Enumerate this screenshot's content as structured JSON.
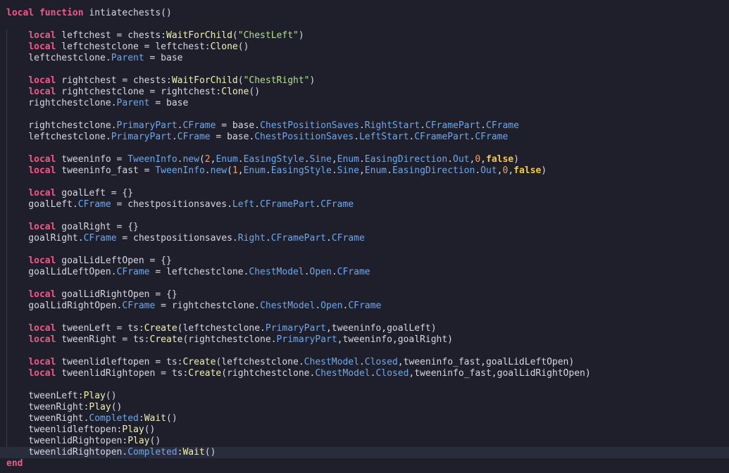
{
  "code_lines": [
    [
      [
        "kw",
        "local function "
      ],
      [
        "plain",
        "intiatechests()"
      ]
    ],
    [],
    [
      [
        "plain",
        "    "
      ],
      [
        "kw",
        "local"
      ],
      [
        "plain",
        " leftchest = chests:"
      ],
      [
        "fn",
        "WaitForChild"
      ],
      [
        "plain",
        "("
      ],
      [
        "str",
        "\"ChestLeft\""
      ],
      [
        "plain",
        ")"
      ]
    ],
    [
      [
        "plain",
        "    "
      ],
      [
        "kw",
        "local"
      ],
      [
        "plain",
        " leftchestclone = leftchest:"
      ],
      [
        "fn",
        "Clone"
      ],
      [
        "plain",
        "()"
      ]
    ],
    [
      [
        "plain",
        "    leftchestclone."
      ],
      [
        "prop",
        "Parent"
      ],
      [
        "plain",
        " = base"
      ]
    ],
    [],
    [
      [
        "plain",
        "    "
      ],
      [
        "kw",
        "local"
      ],
      [
        "plain",
        " rightchest = chests:"
      ],
      [
        "fn",
        "WaitForChild"
      ],
      [
        "plain",
        "("
      ],
      [
        "str",
        "\"ChestRight\""
      ],
      [
        "plain",
        ")"
      ]
    ],
    [
      [
        "plain",
        "    "
      ],
      [
        "kw",
        "local"
      ],
      [
        "plain",
        " rightchestclone = rightchest:"
      ],
      [
        "fn",
        "Clone"
      ],
      [
        "plain",
        "()"
      ]
    ],
    [
      [
        "plain",
        "    rightchestclone."
      ],
      [
        "prop",
        "Parent"
      ],
      [
        "plain",
        " = base"
      ]
    ],
    [],
    [
      [
        "plain",
        "    rightchestclone."
      ],
      [
        "prop",
        "PrimaryPart"
      ],
      [
        "plain",
        "."
      ],
      [
        "prop",
        "CFrame"
      ],
      [
        "plain",
        " = base."
      ],
      [
        "prop",
        "ChestPositionSaves"
      ],
      [
        "plain",
        "."
      ],
      [
        "prop",
        "RightStart"
      ],
      [
        "plain",
        "."
      ],
      [
        "prop",
        "CFramePart"
      ],
      [
        "plain",
        "."
      ],
      [
        "prop",
        "CFrame"
      ]
    ],
    [
      [
        "plain",
        "    leftchestclone."
      ],
      [
        "prop",
        "PrimaryPart"
      ],
      [
        "plain",
        "."
      ],
      [
        "prop",
        "CFrame"
      ],
      [
        "plain",
        " = base."
      ],
      [
        "prop",
        "ChestPositionSaves"
      ],
      [
        "plain",
        "."
      ],
      [
        "prop",
        "LeftStart"
      ],
      [
        "plain",
        "."
      ],
      [
        "prop",
        "CFramePart"
      ],
      [
        "plain",
        "."
      ],
      [
        "prop",
        "CFrame"
      ]
    ],
    [],
    [
      [
        "plain",
        "    "
      ],
      [
        "kw",
        "local"
      ],
      [
        "plain",
        " tweeninfo = "
      ],
      [
        "prop",
        "TweenInfo"
      ],
      [
        "plain",
        "."
      ],
      [
        "prop",
        "new"
      ],
      [
        "plain",
        "("
      ],
      [
        "num",
        "2"
      ],
      [
        "plain",
        ","
      ],
      [
        "prop",
        "Enum"
      ],
      [
        "plain",
        "."
      ],
      [
        "prop",
        "EasingStyle"
      ],
      [
        "plain",
        "."
      ],
      [
        "prop",
        "Sine"
      ],
      [
        "plain",
        ","
      ],
      [
        "prop",
        "Enum"
      ],
      [
        "plain",
        "."
      ],
      [
        "prop",
        "EasingDirection"
      ],
      [
        "plain",
        "."
      ],
      [
        "prop",
        "Out"
      ],
      [
        "plain",
        ","
      ],
      [
        "num",
        "0"
      ],
      [
        "plain",
        ","
      ],
      [
        "bool",
        "false"
      ],
      [
        "plain",
        ")"
      ]
    ],
    [
      [
        "plain",
        "    "
      ],
      [
        "kw",
        "local"
      ],
      [
        "plain",
        " tweeninfo_fast = "
      ],
      [
        "prop",
        "TweenInfo"
      ],
      [
        "plain",
        "."
      ],
      [
        "prop",
        "new"
      ],
      [
        "plain",
        "("
      ],
      [
        "num",
        "1"
      ],
      [
        "plain",
        ","
      ],
      [
        "prop",
        "Enum"
      ],
      [
        "plain",
        "."
      ],
      [
        "prop",
        "EasingStyle"
      ],
      [
        "plain",
        "."
      ],
      [
        "prop",
        "Sine"
      ],
      [
        "plain",
        ","
      ],
      [
        "prop",
        "Enum"
      ],
      [
        "plain",
        "."
      ],
      [
        "prop",
        "EasingDirection"
      ],
      [
        "plain",
        "."
      ],
      [
        "prop",
        "Out"
      ],
      [
        "plain",
        ","
      ],
      [
        "num",
        "0"
      ],
      [
        "plain",
        ","
      ],
      [
        "bool",
        "false"
      ],
      [
        "plain",
        ")"
      ]
    ],
    [],
    [
      [
        "plain",
        "    "
      ],
      [
        "kw",
        "local"
      ],
      [
        "plain",
        " goalLeft = {}"
      ]
    ],
    [
      [
        "plain",
        "    goalLeft."
      ],
      [
        "prop",
        "CFrame"
      ],
      [
        "plain",
        " = chestpositionsaves."
      ],
      [
        "prop",
        "Left"
      ],
      [
        "plain",
        "."
      ],
      [
        "prop",
        "CFramePart"
      ],
      [
        "plain",
        "."
      ],
      [
        "prop",
        "CFrame"
      ]
    ],
    [],
    [
      [
        "plain",
        "    "
      ],
      [
        "kw",
        "local"
      ],
      [
        "plain",
        " goalRight = {}"
      ]
    ],
    [
      [
        "plain",
        "    goalRight."
      ],
      [
        "prop",
        "CFrame"
      ],
      [
        "plain",
        " = chestpositionsaves."
      ],
      [
        "prop",
        "Right"
      ],
      [
        "plain",
        "."
      ],
      [
        "prop",
        "CFramePart"
      ],
      [
        "plain",
        "."
      ],
      [
        "prop",
        "CFrame"
      ]
    ],
    [],
    [
      [
        "plain",
        "    "
      ],
      [
        "kw",
        "local"
      ],
      [
        "plain",
        " goalLidLeftOpen = {}"
      ]
    ],
    [
      [
        "plain",
        "    goalLidLeftOpen."
      ],
      [
        "prop",
        "CFrame"
      ],
      [
        "plain",
        " = leftchestclone."
      ],
      [
        "prop",
        "ChestModel"
      ],
      [
        "plain",
        "."
      ],
      [
        "prop",
        "Open"
      ],
      [
        "plain",
        "."
      ],
      [
        "prop",
        "CFrame"
      ]
    ],
    [],
    [
      [
        "plain",
        "    "
      ],
      [
        "kw",
        "local"
      ],
      [
        "plain",
        " goalLidRightOpen = {}"
      ]
    ],
    [
      [
        "plain",
        "    goalLidRightOpen."
      ],
      [
        "prop",
        "CFrame"
      ],
      [
        "plain",
        " = rightchestclone."
      ],
      [
        "prop",
        "ChestModel"
      ],
      [
        "plain",
        "."
      ],
      [
        "prop",
        "Open"
      ],
      [
        "plain",
        "."
      ],
      [
        "prop",
        "CFrame"
      ]
    ],
    [],
    [
      [
        "plain",
        "    "
      ],
      [
        "kw",
        "local"
      ],
      [
        "plain",
        " tweenLeft = ts:"
      ],
      [
        "fn",
        "Create"
      ],
      [
        "plain",
        "(leftchestclone."
      ],
      [
        "prop",
        "PrimaryPart"
      ],
      [
        "plain",
        ",tweeninfo,goalLeft)"
      ]
    ],
    [
      [
        "plain",
        "    "
      ],
      [
        "kw",
        "local"
      ],
      [
        "plain",
        " tweenRight = ts:"
      ],
      [
        "fn",
        "Create"
      ],
      [
        "plain",
        "(rightchestclone."
      ],
      [
        "prop",
        "PrimaryPart"
      ],
      [
        "plain",
        ",tweeninfo,goalRight)"
      ]
    ],
    [],
    [
      [
        "plain",
        "    "
      ],
      [
        "kw",
        "local"
      ],
      [
        "plain",
        " tweenlidleftopen = ts:"
      ],
      [
        "fn",
        "Create"
      ],
      [
        "plain",
        "(leftchestclone."
      ],
      [
        "prop",
        "ChestModel"
      ],
      [
        "plain",
        "."
      ],
      [
        "prop",
        "Closed"
      ],
      [
        "plain",
        ",tweeninfo_fast,goalLidLeftOpen)"
      ]
    ],
    [
      [
        "plain",
        "    "
      ],
      [
        "kw",
        "local"
      ],
      [
        "plain",
        " tweenlidRightopen = ts:"
      ],
      [
        "fn",
        "Create"
      ],
      [
        "plain",
        "(rightchestclone."
      ],
      [
        "prop",
        "ChestModel"
      ],
      [
        "plain",
        "."
      ],
      [
        "prop",
        "Closed"
      ],
      [
        "plain",
        ",tweeninfo_fast,goalLidRightOpen)"
      ]
    ],
    [],
    [
      [
        "plain",
        "    tweenLeft:"
      ],
      [
        "fn",
        "Play"
      ],
      [
        "plain",
        "()"
      ]
    ],
    [
      [
        "plain",
        "    tweenRight:"
      ],
      [
        "fn",
        "Play"
      ],
      [
        "plain",
        "()"
      ]
    ],
    [
      [
        "plain",
        "    tweenRight."
      ],
      [
        "prop",
        "Completed"
      ],
      [
        "plain",
        ":"
      ],
      [
        "fn",
        "Wait"
      ],
      [
        "plain",
        "()"
      ]
    ],
    [
      [
        "plain",
        "    tweenlidleftopen:"
      ],
      [
        "fn",
        "Play"
      ],
      [
        "plain",
        "()"
      ]
    ],
    [
      [
        "plain",
        "    tweenlidRightopen:"
      ],
      [
        "fn",
        "Play"
      ],
      [
        "plain",
        "()"
      ]
    ],
    [
      [
        "plain",
        "    tweenlidRightopen."
      ],
      [
        "prop",
        "Completed"
      ],
      [
        "plain",
        ":"
      ],
      [
        "fn",
        "Wait"
      ],
      [
        "plain",
        "()"
      ]
    ],
    [
      [
        "kw",
        "end"
      ]
    ]
  ],
  "cursor_line_index": 39
}
